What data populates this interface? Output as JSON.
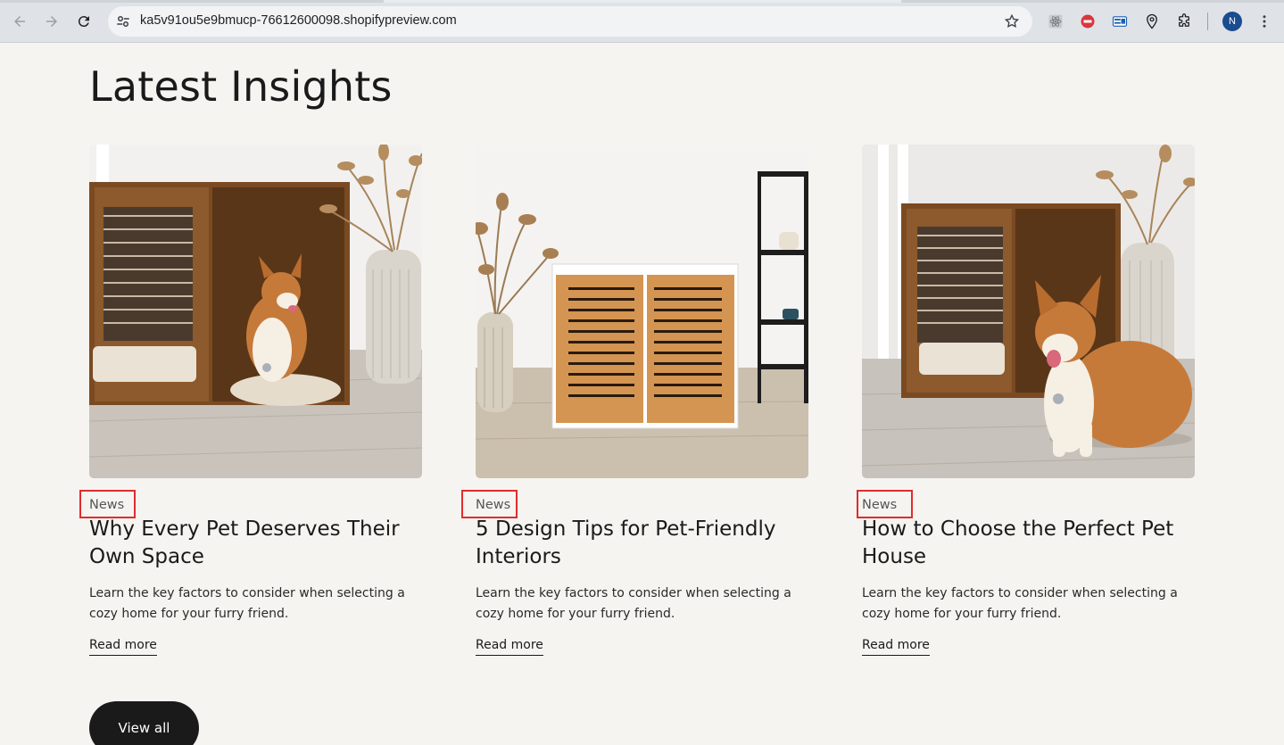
{
  "browser": {
    "url": "ka5v91ou5e9bmucp-76612600098.shopifypreview.com",
    "profile_initial": "N",
    "icons": [
      "back-icon",
      "forward-icon",
      "reload-icon",
      "site-settings-icon",
      "bookmark-star-icon",
      "react-devtools-icon",
      "ext-red-icon",
      "ext-blue-icon",
      "location-pin-icon",
      "extensions-puzzle-icon",
      "menu-kebab-icon"
    ]
  },
  "page": {
    "heading": "Latest Insights",
    "view_all_label": "View all"
  },
  "articles": [
    {
      "tag": "News",
      "title": "Why Every Pet Deserves Their Own Space",
      "description": "Learn the key factors to consider when selecting a cozy home for your furry friend.",
      "read_more": "Read more"
    },
    {
      "tag": "News",
      "title": "5 Design Tips for Pet-Friendly Interiors",
      "description": "Learn the key factors to consider when selecting a cozy home for your furry friend.",
      "read_more": "Read more"
    },
    {
      "tag": "News",
      "title": "How to Choose the Perfect Pet House",
      "description": "Learn the key factors to consider when selecting a cozy home for your furry friend.",
      "read_more": "Read more"
    }
  ],
  "colors": {
    "page_bg": "#f5f4f0",
    "highlight_box": "#e02c2c",
    "button_bg": "#1a1a1a"
  }
}
